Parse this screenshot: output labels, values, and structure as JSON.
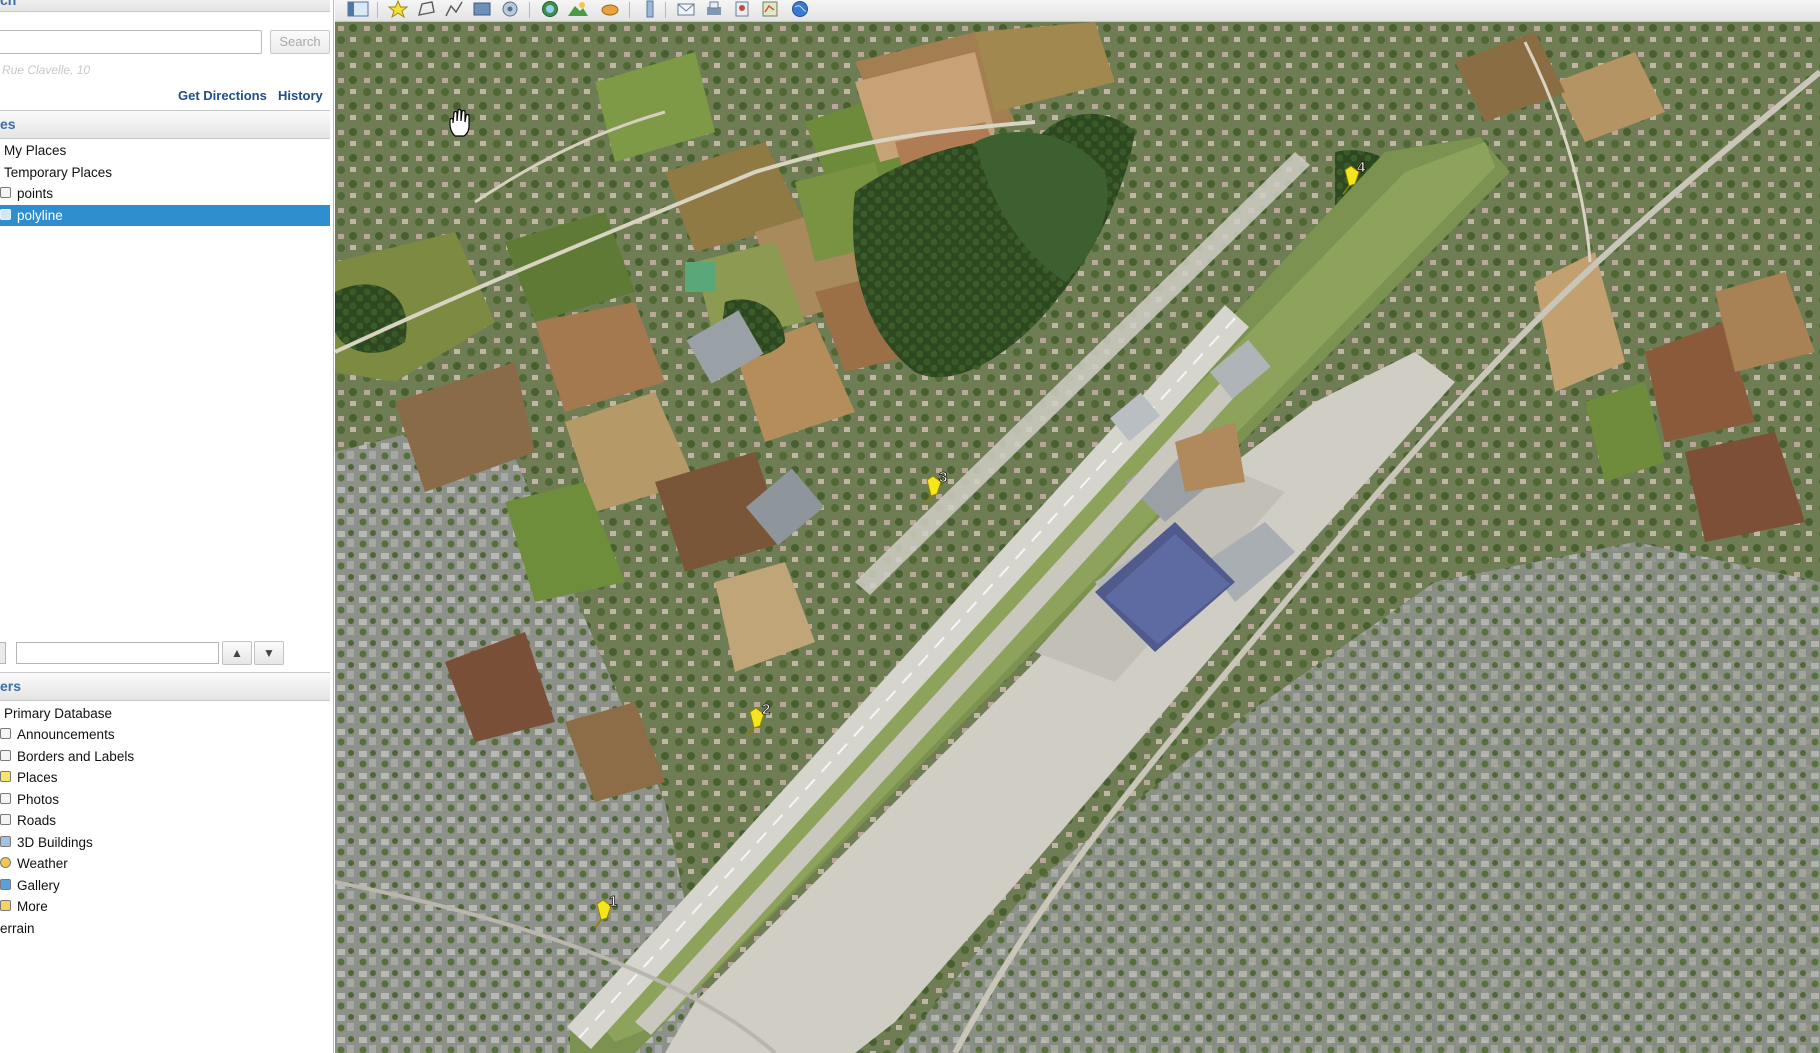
{
  "sidebar": {
    "search": {
      "header": "ch",
      "placeholder": "",
      "button": "Search",
      "hint": "Rue Clavelle, 10",
      "get_directions": "Get Directions",
      "history": "History"
    },
    "places": {
      "header": "es",
      "items": [
        {
          "label": "My Places"
        },
        {
          "label": "Temporary Places"
        },
        {
          "label": "points"
        },
        {
          "label": "polyline",
          "selected": true
        }
      ]
    },
    "layers": {
      "header": "ers",
      "items": [
        {
          "label": "Primary Database"
        },
        {
          "label": "Announcements"
        },
        {
          "label": "Borders and Labels"
        },
        {
          "label": "Places"
        },
        {
          "label": "Photos"
        },
        {
          "label": "Roads"
        },
        {
          "label": "3D Buildings"
        },
        {
          "label": "Weather"
        },
        {
          "label": "Gallery"
        },
        {
          "label": "More"
        },
        {
          "label": "errain"
        }
      ]
    }
  },
  "toolbar": {
    "icons": [
      "sidebar-toggle-icon",
      "placemark-icon",
      "polygon-icon",
      "path-icon",
      "image-overlay-icon",
      "record-tour-icon",
      "historical-imagery-icon",
      "sunlight-icon",
      "planets-icon",
      "ruler-icon",
      "email-icon",
      "print-icon",
      "save-image-icon",
      "maps-icon",
      "earth-icon"
    ]
  },
  "map": {
    "pins": [
      {
        "label": "1"
      },
      {
        "label": "2"
      },
      {
        "label": "3"
      },
      {
        "label": "4"
      }
    ],
    "colors": {
      "pin": "#f4e51c",
      "runway": "#d7d6cf",
      "grass": "#6f8a45",
      "forest": "#2f4a22",
      "urban": "#9a9c98"
    }
  }
}
